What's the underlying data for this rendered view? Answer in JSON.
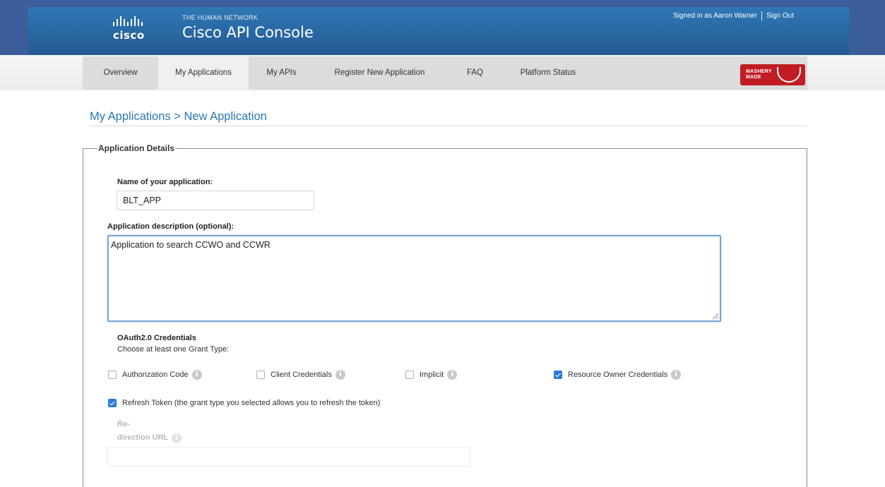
{
  "header": {
    "logo_text": "cisco",
    "tagline": "THE HUMAN NETWORK",
    "title": "Cisco API Console",
    "signed_in": "Signed in as Aaron Warner",
    "sign_out": "Sign Out"
  },
  "nav": {
    "items": [
      "Overview",
      "My Applications",
      "My APIs",
      "Register New Application",
      "FAQ",
      "Platform Status"
    ],
    "active": "My Applications",
    "badge_text": "MASHERY MADE"
  },
  "breadcrumb": "My Applications > New Application",
  "form": {
    "legend": "Application Details",
    "name_label": "Name of your application:",
    "name_value": "BLT_APP",
    "description_label": "Application description (optional):",
    "description_value": "Application to search CCWO and CCWR",
    "oauth_title": "OAuth2.0 Credentials",
    "oauth_hint": "Choose at least one Grant Type:",
    "grants": [
      {
        "label": "Authorization Code",
        "checked": false
      },
      {
        "label": "Client Credentials",
        "checked": false
      },
      {
        "label": "Implicit",
        "checked": false
      },
      {
        "label": "Resource Owner Credentials",
        "checked": true
      }
    ],
    "refresh_label": "Refresh Token (the grant type you selected allows you to refresh the token)",
    "refresh_checked": true,
    "redirect_label_line1": "Re-",
    "redirect_label_line2": "direction URL",
    "redirect_value": ""
  },
  "colors": {
    "header_blue": "#2a6aa6",
    "link_blue": "#2a78b4",
    "check_blue": "#2b7bd6",
    "badge_red": "#c11c24"
  }
}
